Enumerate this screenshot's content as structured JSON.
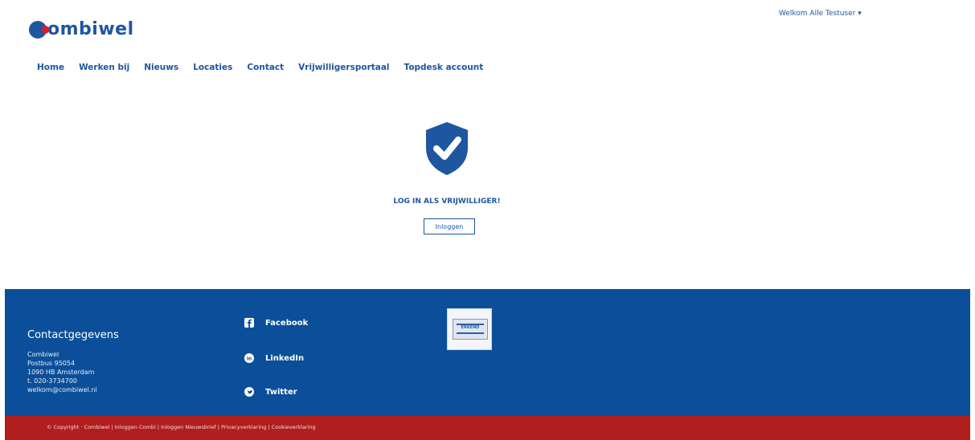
{
  "header": {
    "logo_text": "ombiwel",
    "user_menu": "Welkom Alle Testuser ▾"
  },
  "nav": {
    "items": [
      "Home",
      "Werken bij",
      "Nieuws",
      "Locaties",
      "Contact",
      "Vrijwilligersportaal",
      "Topdesk account"
    ]
  },
  "login": {
    "title": "LOG IN ALS VRIJWILLIGER!",
    "button": "Inloggen",
    "shield_color": "#1e56a0"
  },
  "footer": {
    "contact_title": "Contactgegevens",
    "contact_lines": [
      "Combiwel",
      "Postbus 95054",
      "1090 HB Amsterdam",
      "t. 020-3734700",
      "welkom@combiwel.nl"
    ],
    "social": [
      "Facebook",
      "LinkedIn",
      "Twitter"
    ],
    "badge_label": "ERKEND",
    "copyright": "© Copyright · Combiwel | Inloggen Combi | Inloggen Nieuwsbrief | Privacyverklaring | Cookieverklaring"
  },
  "colors": {
    "brand_blue": "#1e56a0",
    "footer_blue": "#0b4f9a",
    "footer_red": "#b01e1e",
    "logo_red": "#d3202b"
  }
}
